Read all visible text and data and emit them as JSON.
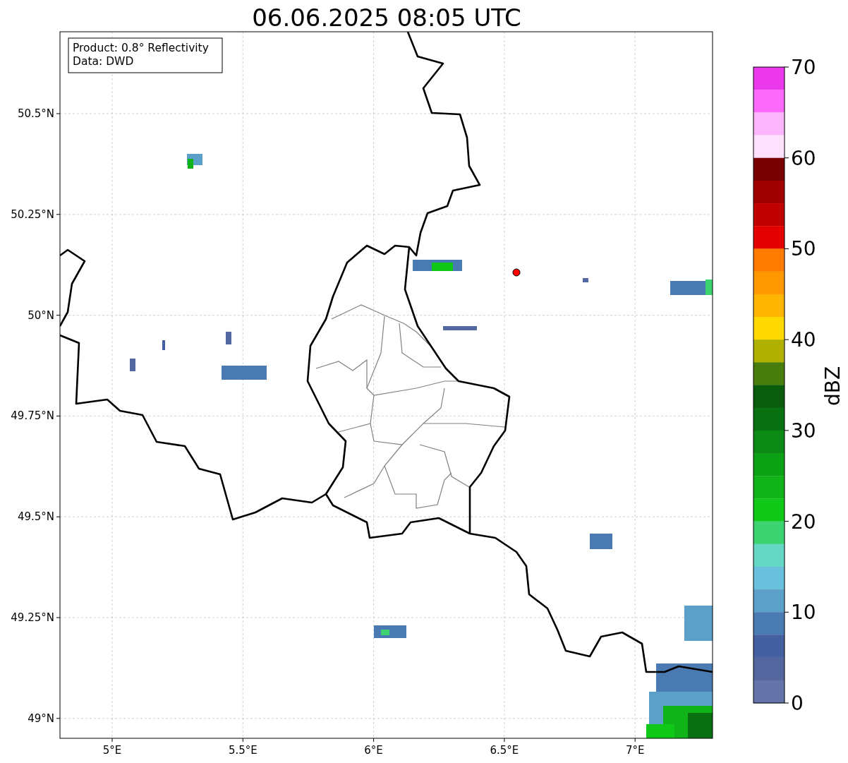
{
  "title": "06.06.2025 08:05 UTC",
  "info_box": [
    "Product: 0.8° Reflectivity",
    "Data: DWD"
  ],
  "map": {
    "x_ticks": [
      "5°E",
      "5.5°E",
      "6°E",
      "6.5°E",
      "7°E"
    ],
    "y_ticks": [
      "50.5°N",
      "50.25°N",
      "50°N",
      "49.75°N",
      "49.5°N",
      "49.25°N",
      "49°N"
    ]
  },
  "colorbar": {
    "label": "dBZ",
    "ticks": [
      "70",
      "60",
      "50",
      "40",
      "30",
      "20",
      "10",
      "0"
    ],
    "bands": [
      {
        "color": "#ea38ea"
      },
      {
        "color": "#fc6afc"
      },
      {
        "color": "#fcb4fc"
      },
      {
        "color": "#fde0fc"
      },
      {
        "color": "#780000"
      },
      {
        "color": "#a00000"
      },
      {
        "color": "#c00000"
      },
      {
        "color": "#e40000"
      },
      {
        "color": "#ff7c00"
      },
      {
        "color": "#ff9800"
      },
      {
        "color": "#ffb400"
      },
      {
        "color": "#ffd800"
      },
      {
        "color": "#b0b000"
      },
      {
        "color": "#487c0c"
      },
      {
        "color": "#085c0c"
      },
      {
        "color": "#087010"
      },
      {
        "color": "#0c8814"
      },
      {
        "color": "#0ca014"
      },
      {
        "color": "#10b418"
      },
      {
        "color": "#10c818"
      },
      {
        "color": "#3cd470"
      },
      {
        "color": "#64d8c4"
      },
      {
        "color": "#68c0dc"
      },
      {
        "color": "#5aa0c8"
      },
      {
        "color": "#4a7ab2"
      },
      {
        "color": "#4460a0"
      },
      {
        "color": "#54669e"
      },
      {
        "color": "#6474a8"
      }
    ]
  }
}
